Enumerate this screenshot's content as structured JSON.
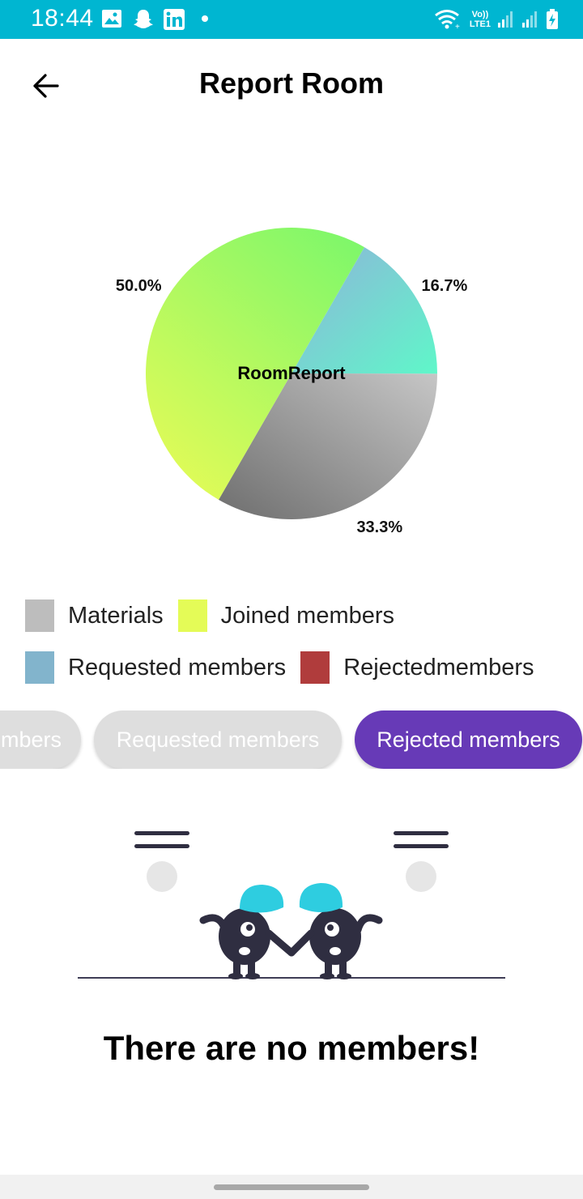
{
  "status_bar": {
    "time": "18:44",
    "left_icons": [
      "image-icon",
      "snapchat-icon",
      "linkedin-icon",
      "dot-icon"
    ],
    "network_label_top": "Vo))",
    "network_label_bottom": "LTE1",
    "right_icons": [
      "wifi-icon",
      "signal-icon",
      "signal-icon",
      "battery-charging-icon"
    ]
  },
  "app_bar": {
    "back_icon": "arrow-left-icon",
    "title": "Report Room"
  },
  "chart_data": {
    "type": "pie",
    "title": "",
    "center_label": "RoomReport",
    "slices": [
      {
        "name": "Requested members",
        "value": 16.7,
        "label": "16.7%",
        "color": "#7dc0d6"
      },
      {
        "name": "Materials",
        "value": 33.3,
        "label": "33.3%",
        "color": "#a9a9a9"
      },
      {
        "name": "Joined members",
        "value": 50.0,
        "label": "50.0%",
        "color": "#b4f55a"
      }
    ],
    "legend": [
      {
        "label": "Materials",
        "color": "#bdbdbd"
      },
      {
        "label": "Joined members",
        "color": "#e4fb57"
      },
      {
        "label": "Requested members",
        "color": "#82b4cc"
      },
      {
        "label": "Rejectedmembers",
        "color": "#b03c3c"
      }
    ]
  },
  "chips": [
    {
      "label": "Joined members",
      "visible_label": "mbers",
      "active": false
    },
    {
      "label": "Requested members",
      "active": false
    },
    {
      "label": "Rejected members",
      "active": true
    }
  ],
  "colors": {
    "accent": "#673ab7",
    "status_bar": "#00b6d1",
    "chip_inactive": "#dedede",
    "illustration_cap": "#2ecde0",
    "illustration_body": "#2f2e41"
  },
  "empty_state": {
    "illustration": "two-characters-holding-hands-illustration",
    "message": "There are no members!"
  }
}
